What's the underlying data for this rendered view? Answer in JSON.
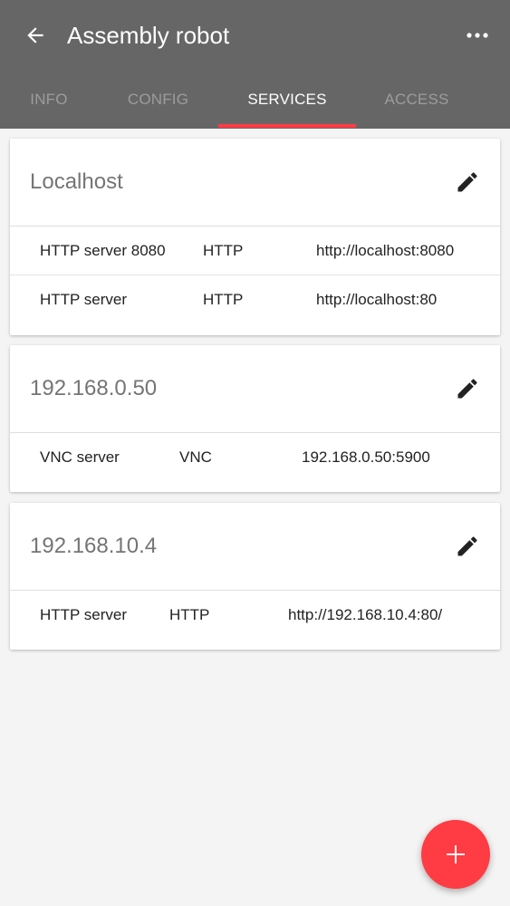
{
  "header": {
    "title": "Assembly robot",
    "back_icon": "arrow-back-icon",
    "more_icon": "more-horiz-icon",
    "background": "#666666"
  },
  "tabs": [
    {
      "label": "INFO",
      "active": false
    },
    {
      "label": "CONFIG",
      "active": false
    },
    {
      "label": "SERVICES",
      "active": true
    },
    {
      "label": "ACCESS",
      "active": false
    }
  ],
  "accent_color": "#ff3b43",
  "hosts": [
    {
      "name": "Localhost",
      "services": [
        {
          "name": "HTTP server 8080",
          "protocol": "HTTP",
          "address": "http://localhost:8080"
        },
        {
          "name": "HTTP server",
          "protocol": "HTTP",
          "address": "http://localhost:80"
        }
      ]
    },
    {
      "name": "192.168.0.50",
      "services": [
        {
          "name": "VNC server",
          "protocol": "VNC",
          "address": "192.168.0.50:5900"
        }
      ]
    },
    {
      "name": "192.168.10.4",
      "services": [
        {
          "name": "HTTP server",
          "protocol": "HTTP",
          "address": "http://192.168.10.4:80/"
        }
      ]
    }
  ],
  "fab": {
    "icon": "plus-icon"
  }
}
